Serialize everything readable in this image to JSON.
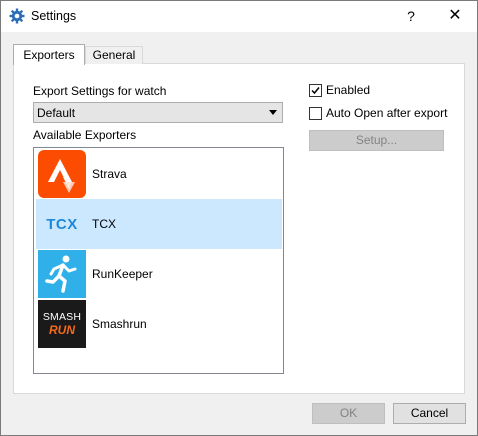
{
  "window": {
    "title": "Settings",
    "help_label": "?",
    "close_label": "✕"
  },
  "tabs": [
    {
      "label": "Exporters",
      "active": true
    },
    {
      "label": "General",
      "active": false
    }
  ],
  "exporters_tab": {
    "export_settings_label": "Export Settings for watch",
    "watch_select": {
      "value": "Default"
    },
    "available_label": "Available Exporters",
    "exporters": [
      {
        "label": "Strava",
        "icon": "strava-logo",
        "selected": false
      },
      {
        "label": "TCX",
        "icon": "tcx-logo",
        "icon_text": "TCX",
        "selected": true
      },
      {
        "label": "RunKeeper",
        "icon": "runkeeper-logo",
        "selected": false
      },
      {
        "label": "Smashrun",
        "icon": "smashrun-logo",
        "icon_text_top": "SMASH",
        "icon_text_bottom": "RUN",
        "selected": false
      }
    ],
    "enabled": {
      "label": "Enabled",
      "checked": true
    },
    "auto_open": {
      "label": "Auto Open after export",
      "checked": false
    },
    "setup_button": {
      "label": "Setup...",
      "enabled": false
    }
  },
  "footer": {
    "ok_label": "OK",
    "cancel_label": "Cancel"
  },
  "colors": {
    "selection": "#cce8ff",
    "strava": "#fc4c02",
    "tcx_text": "#1e88d8",
    "runkeeper": "#2fb0e8",
    "smashrun_bg": "#1a1a1a",
    "smashrun_run": "#f26a1b"
  }
}
